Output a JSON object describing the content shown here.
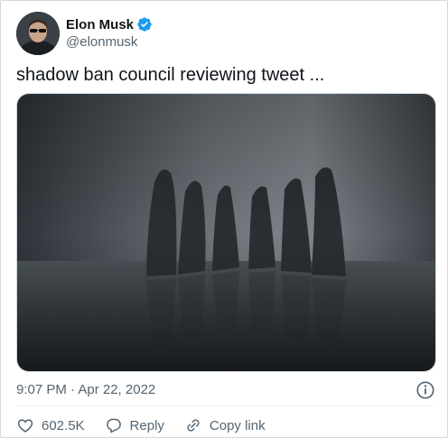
{
  "author": {
    "display_name": "Elon Musk",
    "handle": "@elonmusk"
  },
  "tweet": {
    "text": "shadow ban council reviewing tweet ...",
    "time": "9:07 PM · Apr 22, 2022"
  },
  "actions": {
    "likes": "602.5K",
    "reply_label": "Reply",
    "copy_link_label": "Copy link"
  },
  "colors": {
    "verified": "#1d9bf0",
    "secondary_text": "#536471"
  }
}
